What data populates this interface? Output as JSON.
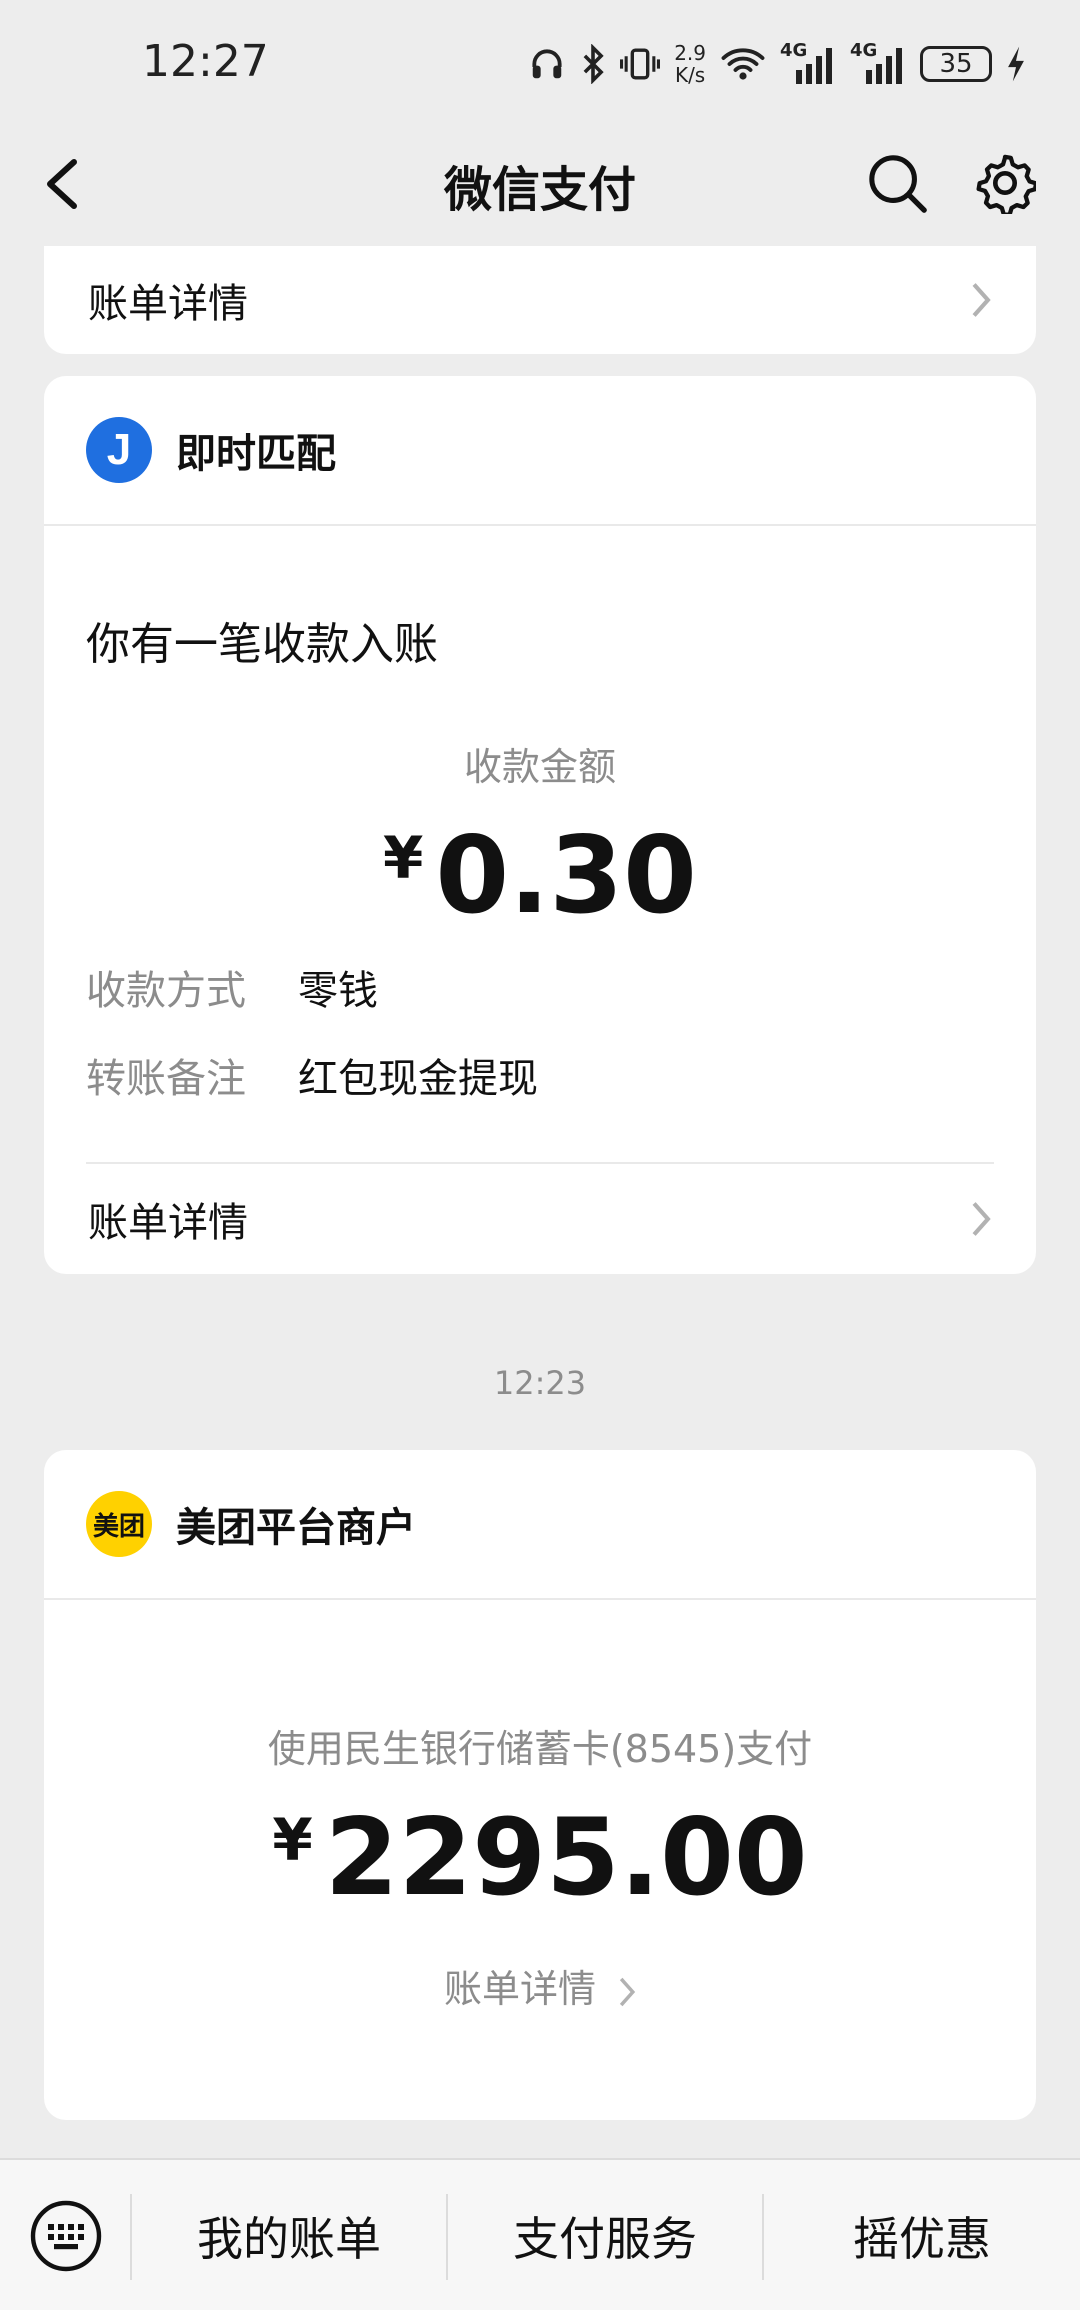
{
  "status_bar": {
    "time": "12:27",
    "net_speed_value": "2.9",
    "net_speed_unit": "K/s",
    "signal1": "4G",
    "signal2": "4G",
    "battery": "35"
  },
  "nav": {
    "title": "微信支付"
  },
  "top_card": {
    "detail_label": "账单详情"
  },
  "card_transfer": {
    "merchant_name": "即时匹配",
    "logo_letter": "J",
    "notice_title": "你有一笔收款入账",
    "amount_label": "收款金额",
    "currency": "¥",
    "amount": "0.30",
    "fields": [
      {
        "key": "收款方式",
        "value": "零钱"
      },
      {
        "key": "转账备注",
        "value": "红包现金提现"
      }
    ],
    "detail_label": "账单详情"
  },
  "timestamp": "12:23",
  "card_payment": {
    "merchant_name": "美团平台商户",
    "logo_text": "美团",
    "payment_method": "使用民生银行储蓄卡(8545)支付",
    "currency": "¥",
    "amount": "2295.00",
    "detail_link": "账单详情"
  },
  "bottom_menu": {
    "items": [
      "我的账单",
      "支付服务",
      "摇优惠"
    ]
  },
  "colors": {
    "background": "#ededed",
    "card": "#ffffff",
    "secondary_text": "#8c8c8c",
    "logo_j": "#1f6fe0",
    "logo_meituan": "#ffd100"
  },
  "icons": [
    "back-arrow-icon",
    "search-icon",
    "gear-icon",
    "chevron-right-icon",
    "keyboard-icon",
    "headphones-icon",
    "bluetooth-icon",
    "vibrate-icon",
    "wifi-icon",
    "signal-icon",
    "battery-icon",
    "charging-icon"
  ]
}
